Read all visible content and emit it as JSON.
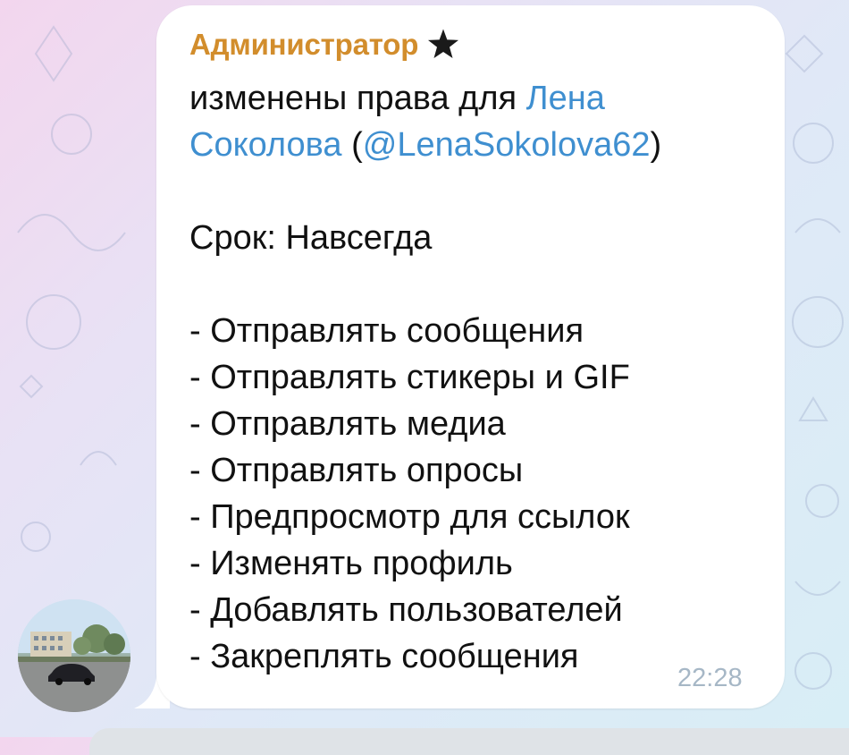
{
  "message": {
    "sender": "Администратор",
    "sender_badge_icon": "star-icon",
    "intro": "изменены права для ",
    "target_name_part1": "Лена",
    "target_name_part2": "Соколова",
    "username_open": "(",
    "username": "@LenaSokolova62",
    "username_close": ")",
    "term_line": "Срок: Навсегда",
    "permissions": [
      "- Отправлять сообщения",
      "- Отправлять стикеры и GIF",
      "- Отправлять медиа",
      "- Отправлять опросы",
      "- Предпросмотр для ссылок",
      "- Изменять профиль",
      "- Добавлять пользователей",
      "- Закреплять сообщения"
    ],
    "time": "22:28"
  },
  "colors": {
    "sender": "#d28d2c",
    "link": "#3f8fd0",
    "time": "#a6b7c6",
    "bubble": "#ffffff"
  }
}
